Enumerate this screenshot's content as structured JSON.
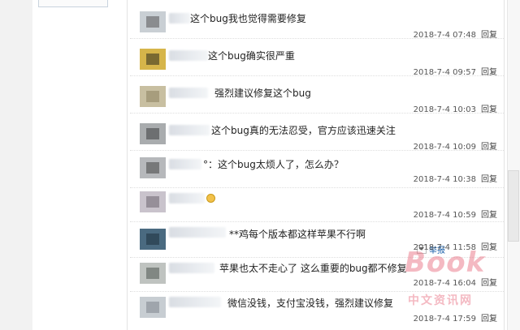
{
  "replies": [
    {
      "content": "这个bug我也觉得需要修复",
      "time": "2018-7-4 07:48",
      "reply_label": "回复"
    },
    {
      "content": "这个bug确实很严重",
      "time": "2018-7-4 09:57",
      "reply_label": "回复"
    },
    {
      "content": "强烈建议修复这个bug",
      "time": "2018-7-4 10:03",
      "reply_label": "回复"
    },
    {
      "content": "这个bug真的无法忍受，官方应该迅速关注",
      "time": "2018-7-4 10:09",
      "reply_label": "回复"
    },
    {
      "content": "°：这个bug太烦人了，怎么办？",
      "time": "2018-7-4 10:38",
      "reply_label": "回复"
    },
    {
      "content": "",
      "time": "2018-7-4 10:59",
      "reply_label": "回复"
    },
    {
      "content": "**鸡每个版本都这样苹果不行啊",
      "time": "2018-7-4 11:58",
      "reply_label": "回复",
      "report_label": "举报"
    },
    {
      "content": "苹果也太不走心了 这么重要的bug都不修复",
      "time": "2018-7-4 16:04",
      "reply_label": "回复"
    },
    {
      "content": "微信没钱，支付宝没钱，强烈建议修复",
      "time": "2018-7-4 17:59",
      "reply_label": "回复"
    }
  ],
  "watermark": {
    "logo": "Book",
    "subtitle": "中文资讯网"
  },
  "icons": {
    "emoji": "smiley-emoji-icon",
    "report": "triangle-down-icon"
  }
}
